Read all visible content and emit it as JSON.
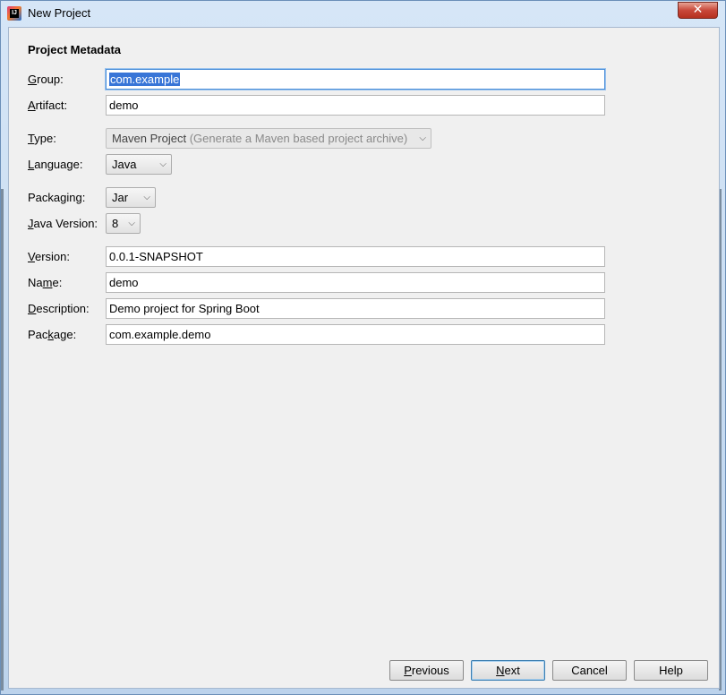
{
  "window": {
    "title": "New Project",
    "app_icon_text": "IJ",
    "close_symbol": "✕"
  },
  "section_title": "Project Metadata",
  "fields": {
    "group": {
      "label_underlined": "G",
      "label_rest": "roup:",
      "value": "com.example"
    },
    "artifact": {
      "label_underlined": "A",
      "label_rest": "rtifact:",
      "value": "demo"
    },
    "type": {
      "label_underlined": "T",
      "label_rest": "ype:",
      "value": "Maven Project",
      "hint": "(Generate a Maven based project archive)"
    },
    "language": {
      "label_underlined": "L",
      "label_rest": "anguage:",
      "value": "Java"
    },
    "packaging": {
      "label_pre": "Packa",
      "label_underlined": "g",
      "label_rest": "ing:",
      "value": "Jar"
    },
    "java_version": {
      "label_underlined": "J",
      "label_rest": "ava Version:",
      "value": "8"
    },
    "version": {
      "label_underlined": "V",
      "label_rest": "ersion:",
      "value": "0.0.1-SNAPSHOT"
    },
    "name": {
      "label_pre": "Na",
      "label_underlined": "m",
      "label_rest": "e:",
      "value": "demo"
    },
    "description": {
      "label_underlined": "D",
      "label_rest": "escription:",
      "value": "Demo project for Spring Boot"
    },
    "package": {
      "label_pre": "Pac",
      "label_underlined": "k",
      "label_rest": "age:",
      "value": "com.example.demo"
    }
  },
  "buttons": {
    "previous": {
      "underlined": "P",
      "rest": "revious"
    },
    "next": {
      "underlined": "N",
      "rest": "ext"
    },
    "cancel": "Cancel",
    "help": "Help"
  },
  "icons": {
    "dropdown_arrow": "chevron-down-icon",
    "dropdown_glyph": "⌵"
  },
  "colors": {
    "selection": "#3875d7",
    "focus_border": "#4a8ed8",
    "dialog_background": "#f0f0f0"
  }
}
